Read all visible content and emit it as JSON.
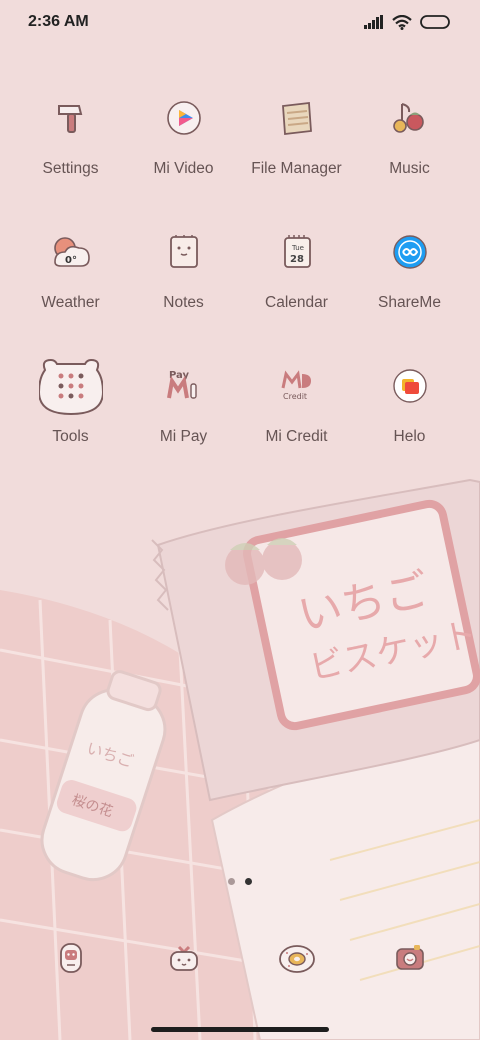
{
  "status_bar": {
    "time": "2:36 AM"
  },
  "apps": [
    {
      "label": "Settings",
      "icon": "hammer-icon"
    },
    {
      "label": "Mi Video",
      "icon": "play-icon"
    },
    {
      "label": "File Manager",
      "icon": "folder-icon"
    },
    {
      "label": "Music",
      "icon": "music-note-icon"
    },
    {
      "label": "Weather",
      "icon": "weather-icon",
      "icon_text": "0°"
    },
    {
      "label": "Notes",
      "icon": "notes-icon"
    },
    {
      "label": "Calendar",
      "icon": "calendar-icon",
      "icon_text": "Tue",
      "icon_text2": "28"
    },
    {
      "label": "ShareMe",
      "icon": "shareme-icon"
    },
    {
      "label": "Tools",
      "icon": "tools-folder-icon"
    },
    {
      "label": "Mi Pay",
      "icon": "mi-pay-icon",
      "icon_text": "Pay"
    },
    {
      "label": "Mi Credit",
      "icon": "mi-credit-icon",
      "icon_text": "Credit"
    },
    {
      "label": "Helo",
      "icon": "helo-icon"
    }
  ],
  "wallpaper": {
    "text_line1": "いちご",
    "text_line2": "ビスケット",
    "bottle_text": "いちご",
    "bottle_label": "桜の花"
  },
  "page_indicator": {
    "pages": 2,
    "current": 2
  },
  "dock": [
    {
      "icon": "phone-icon"
    },
    {
      "icon": "messages-icon"
    },
    {
      "icon": "browser-icon"
    },
    {
      "icon": "camera-icon"
    }
  ],
  "colors": {
    "background": "#f1dcdb",
    "accent": "#c77c80"
  }
}
